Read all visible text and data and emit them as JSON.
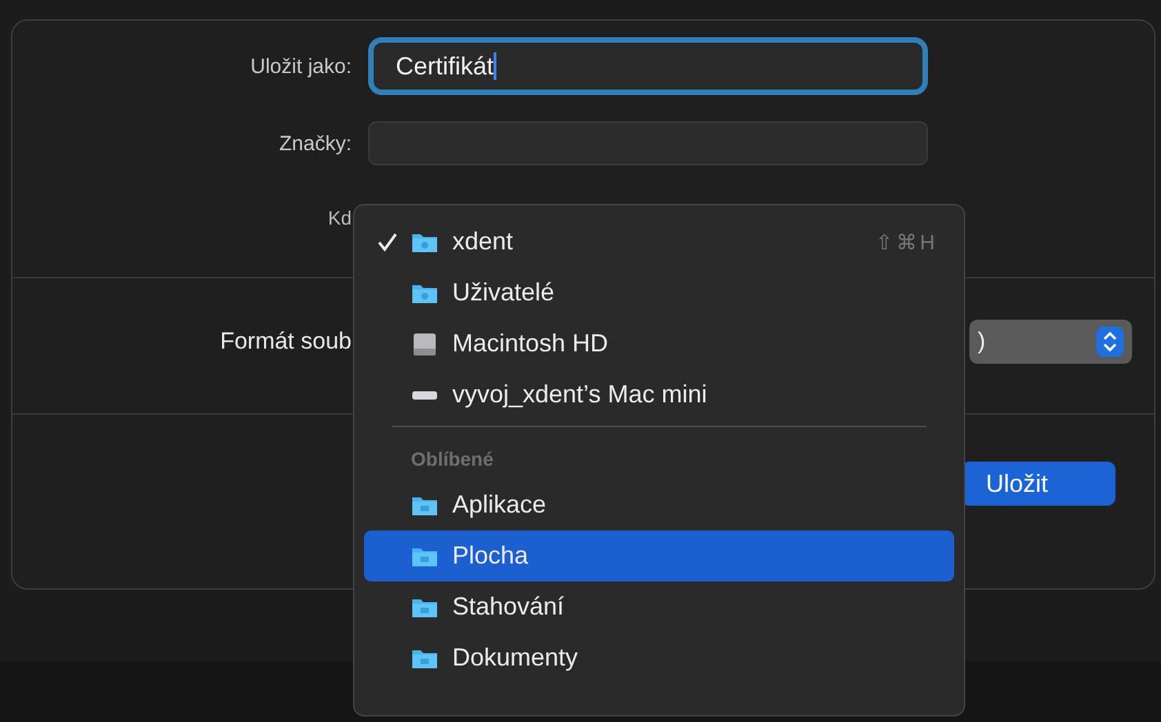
{
  "dialog": {
    "save_as": {
      "label": "Uložit jako:",
      "value": "Certifikát"
    },
    "tags": {
      "label": "Značky:"
    },
    "where": {
      "label": "Kd"
    },
    "format": {
      "label": "Formát soub",
      "value": ")"
    },
    "buttons": [
      {
        "label": "Uložit",
        "kind": "primary"
      }
    ]
  },
  "menu": {
    "locations": [
      {
        "label": "xdent",
        "kind": "folder",
        "checked": true,
        "selected": false,
        "shortcut": "⇧⌘H"
      },
      {
        "label": "Uživatelé",
        "kind": "folder",
        "checked": false,
        "selected": false
      },
      {
        "label": "Macintosh HD",
        "kind": "disk",
        "checked": false,
        "selected": false
      },
      {
        "label": "vyvoj_xdent’s Mac mini",
        "kind": "computer",
        "checked": false,
        "selected": false
      }
    ],
    "favorites": {
      "title": "Oblíbené",
      "items": [
        {
          "label": "Aplikace",
          "kind": "folder",
          "checked": false,
          "selected": false
        },
        {
          "label": "Plocha",
          "kind": "folder",
          "checked": false,
          "selected": true
        },
        {
          "label": "Stahování",
          "kind": "folder",
          "checked": false,
          "selected": false
        },
        {
          "label": "Dokumenty",
          "kind": "folder",
          "checked": false,
          "selected": false
        }
      ]
    }
  }
}
